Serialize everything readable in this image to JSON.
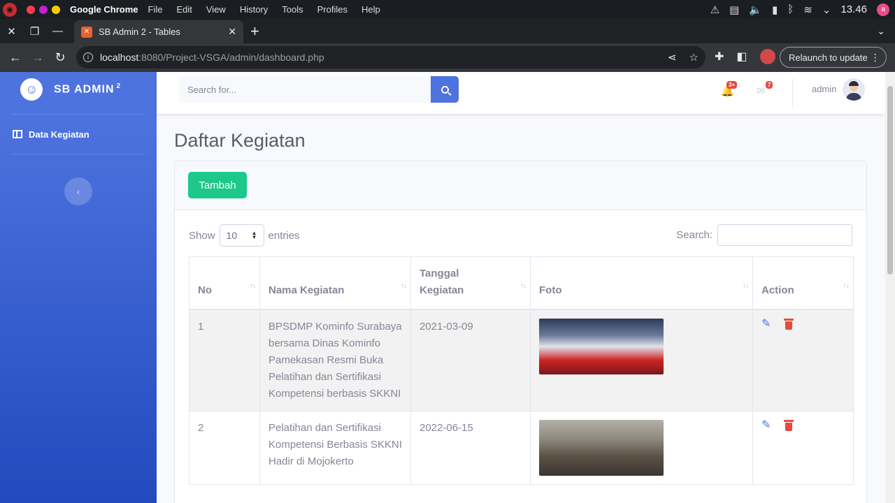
{
  "os": {
    "app_name": "Google Chrome",
    "menu": [
      "File",
      "Edit",
      "View",
      "History",
      "Tools",
      "Profiles",
      "Help"
    ],
    "time": "13.46",
    "avatar_letter": "a"
  },
  "browser": {
    "tab_title": "SB Admin 2 - Tables",
    "url_host": "localhost",
    "url_path": ":8080/Project-VSGA/admin/dashboard.php",
    "relaunch_label": "Relaunch to update"
  },
  "sidebar": {
    "brand": "SB ADMIN",
    "brand_sup": "2",
    "items": [
      {
        "label": "Data Kegiatan"
      }
    ],
    "toggle_icon": "chevron-left-icon"
  },
  "topbar": {
    "search_placeholder": "Search for...",
    "alerts_count": "3+",
    "messages_count": "7",
    "username": "admin"
  },
  "page": {
    "title": "Daftar Kegiatan",
    "add_button": "Tambah",
    "length_prefix": "Show",
    "length_value": "10",
    "length_suffix": "entries",
    "search_label": "Search:"
  },
  "table": {
    "headers": [
      "No",
      "Nama Kegiatan",
      "Tanggal Kegiatan",
      "Foto",
      "Action"
    ],
    "rows": [
      {
        "no": "1",
        "nama": "BPSDMP Kominfo Surabaya bersama Dinas Kominfo Pamekasan Resmi Buka Pelatihan dan Sertifikasi Kompetensi berbasis SKKNI",
        "tanggal": "2021-03-09"
      },
      {
        "no": "2",
        "nama": "Pelatihan dan Sertifikasi Kompetensi Berbasis SKKNI Hadir di Mojokerto",
        "tanggal": "2022-06-15"
      }
    ]
  },
  "colors": {
    "primary": "#4e73df",
    "success": "#1cc88a",
    "danger": "#e74a3b",
    "text_gray": "#858796"
  }
}
